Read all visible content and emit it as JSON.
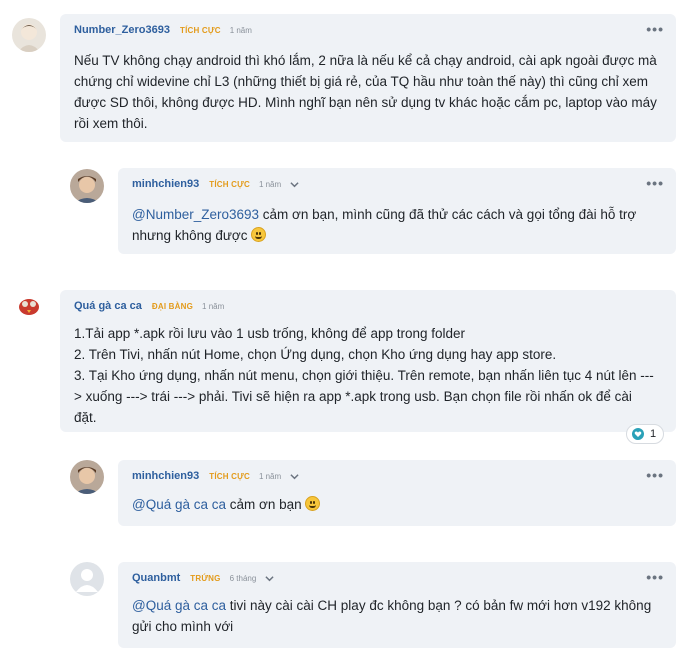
{
  "comments": [
    {
      "author": "Number_Zero3693",
      "badge": "TÍCH CỰC",
      "badge_color": "#e39b1b",
      "time": "1 năm",
      "lines": [
        "Nếu TV không chạy android thì khó lắm, 2 nữa là nếu kể cả chạy android, cài apk ngoài được mà",
        "chứng chỉ widevine chỉ L3 (những thiết bị giá rẻ, của TQ hầu như toàn thế này) thì cũng chỉ xem",
        "được SD thôi, không được HD. Mình nghĩ bạn nên sử dụng tv khác hoặc cắm pc, laptop vào máy",
        "rồi xem thôi."
      ]
    },
    {
      "author": "minhchien93",
      "badge": "TÍCH CỰC",
      "badge_color": "#e39b1b",
      "time": "1 năm",
      "mention": "@Number_Zero3693",
      "line1_rest": " cảm ơn bạn, mình cũng đã thử các cách và gọi tổng đài hỗ trợ",
      "line2": "nhưng không được "
    },
    {
      "author": "Quá gà ca ca",
      "badge": "ĐẠI BÀNG",
      "badge_color": "#e39b1b",
      "time": "1 năm",
      "lines": [
        "1.Tải app *.apk rồi lưu vào 1 usb trống, không để app trong folder",
        "2. Trên Tivi, nhấn nút Home, chọn Ứng dụng, chọn Kho ứng dụng hay app store.",
        "3. Tại Kho ứng dụng, nhấn nút menu, chọn giới thiệu. Trên remote, bạn nhấn liên tục 4 nút lên ---",
        "> xuống ---> trái ---> phải. Tivi sẽ hiện ra app *.apk trong usb. Bạn chọn file rồi nhấn ok để cài",
        "đặt."
      ],
      "reaction_count": "1"
    },
    {
      "author": "minhchien93",
      "badge": "TÍCH CỰC",
      "badge_color": "#e39b1b",
      "time": "1 năm",
      "mention": "@Quá gà ca ca",
      "rest": " cảm ơn bạn "
    },
    {
      "author": "Quanbmt",
      "badge": "TRỨNG",
      "badge_color": "#e39b1b",
      "time": "6 tháng",
      "mention": "@Quá gà ca ca",
      "line1_rest": " tivi này cài cài CH play đc không bạn ? có bản fw mới hơn v192 không",
      "line2": "gửi cho mình với"
    }
  ],
  "more_label": "•••",
  "colors": {
    "bubble": "#eff2f6",
    "link": "#2e5f9e"
  }
}
